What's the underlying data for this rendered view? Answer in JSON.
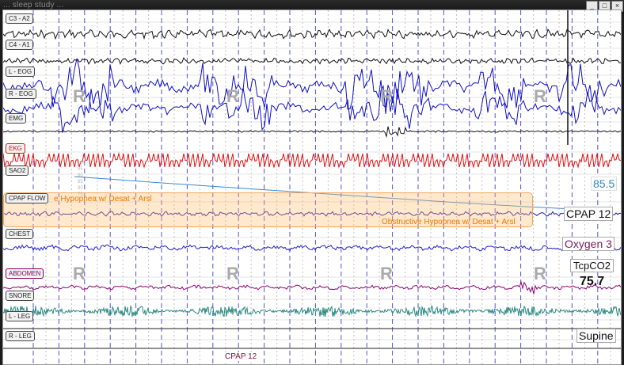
{
  "window": {
    "title": "... sleep study ...",
    "buttons": [
      "_",
      "□",
      "×"
    ]
  },
  "channels": [
    {
      "key": "c3",
      "label": "C3 - A2",
      "style": "normal"
    },
    {
      "key": "c4",
      "label": "C4 - A1",
      "style": "normal"
    },
    {
      "key": "leog",
      "label": "L - EOG",
      "style": "normal"
    },
    {
      "key": "reog",
      "label": "R - EOG",
      "style": "normal"
    },
    {
      "key": "emg",
      "label": "EMG",
      "style": "normal"
    },
    {
      "key": "ekg",
      "label": "EKG",
      "style": "red"
    },
    {
      "key": "sao2",
      "label": "SAO2",
      "style": "normal"
    },
    {
      "key": "cpapflow",
      "label": "CPAP FLOW",
      "style": "normal"
    },
    {
      "key": "chest",
      "label": "CHEST",
      "style": "normal"
    },
    {
      "key": "abdomen",
      "label": "ABDOMEN",
      "style": "mag"
    },
    {
      "key": "snore",
      "label": "SNORE",
      "style": "normal"
    },
    {
      "key": "lleg",
      "label": "L - LEG",
      "style": "normal"
    },
    {
      "key": "rleg",
      "label": "R - LEG",
      "style": "normal"
    }
  ],
  "sleep_stage_marker": "R",
  "event": {
    "label_left": "e Hypopnea w/ Desat + Arsl",
    "label_right": "Obstructive Hypopnea w/ Desat + Arsl"
  },
  "readouts": {
    "sao2": "85.5",
    "cpap": "CPAP 12",
    "oxygen": "Oxygen 3",
    "tcpco2_label": "TcpCO2",
    "tcpco2_value": "75.7",
    "position": "Supine"
  },
  "sao2_scale": [
    "100",
    "95",
    "90",
    "85",
    "80",
    "75"
  ],
  "cpap_bottom": "CPAP 12",
  "colors": {
    "eeg": "#111111",
    "eog": "#1010c8",
    "ekg": "#e01010",
    "sao2": "#3a8ad0",
    "flow": "#1a1ab0",
    "chest": "#2020d0",
    "abdomen": "#900070",
    "snore": "#2a8a80",
    "grid_major": "#1a1acc",
    "grid_minor": "#9a9a9a"
  }
}
